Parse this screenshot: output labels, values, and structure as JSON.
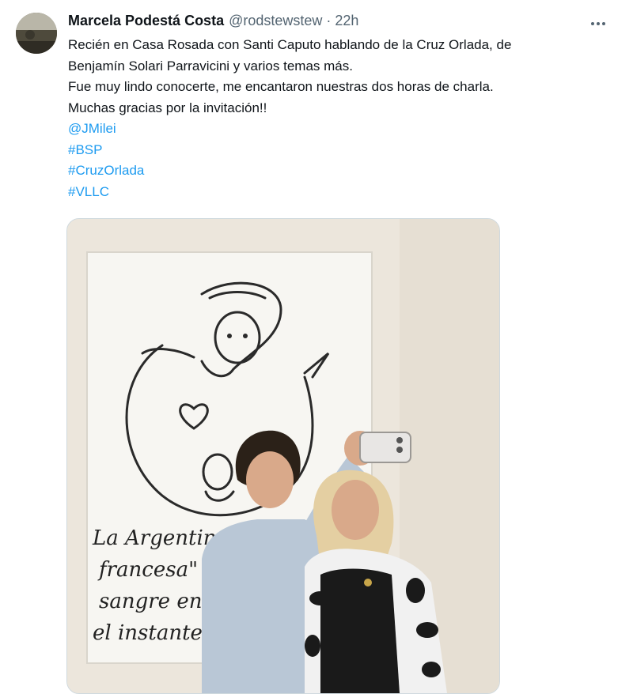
{
  "author": {
    "name": "Marcela Podestá Costa",
    "handle": "@rodstewstew",
    "separator": "·",
    "time": "22h"
  },
  "text": {
    "line1": "Recién en Casa Rosada con Santi Caputo hablando de la Cruz Orlada, de",
    "line2": "Benjamín Solari Parravicini y varios temas más.",
    "line3": "Fue muy lindo conocerte, me encantaron nuestras dos horas de charla.",
    "line4": "Muchas gracias por la invitación!!"
  },
  "links": [
    "@JMilei",
    "#BSP",
    "#CruzOrlada",
    "#VLLC"
  ],
  "media": {
    "handwriting": [
      "La Argentina",
      "francesa\" e",
      "sangre en la",
      "el instante d"
    ]
  },
  "icons": {
    "more": "more-horizontal-icon"
  }
}
